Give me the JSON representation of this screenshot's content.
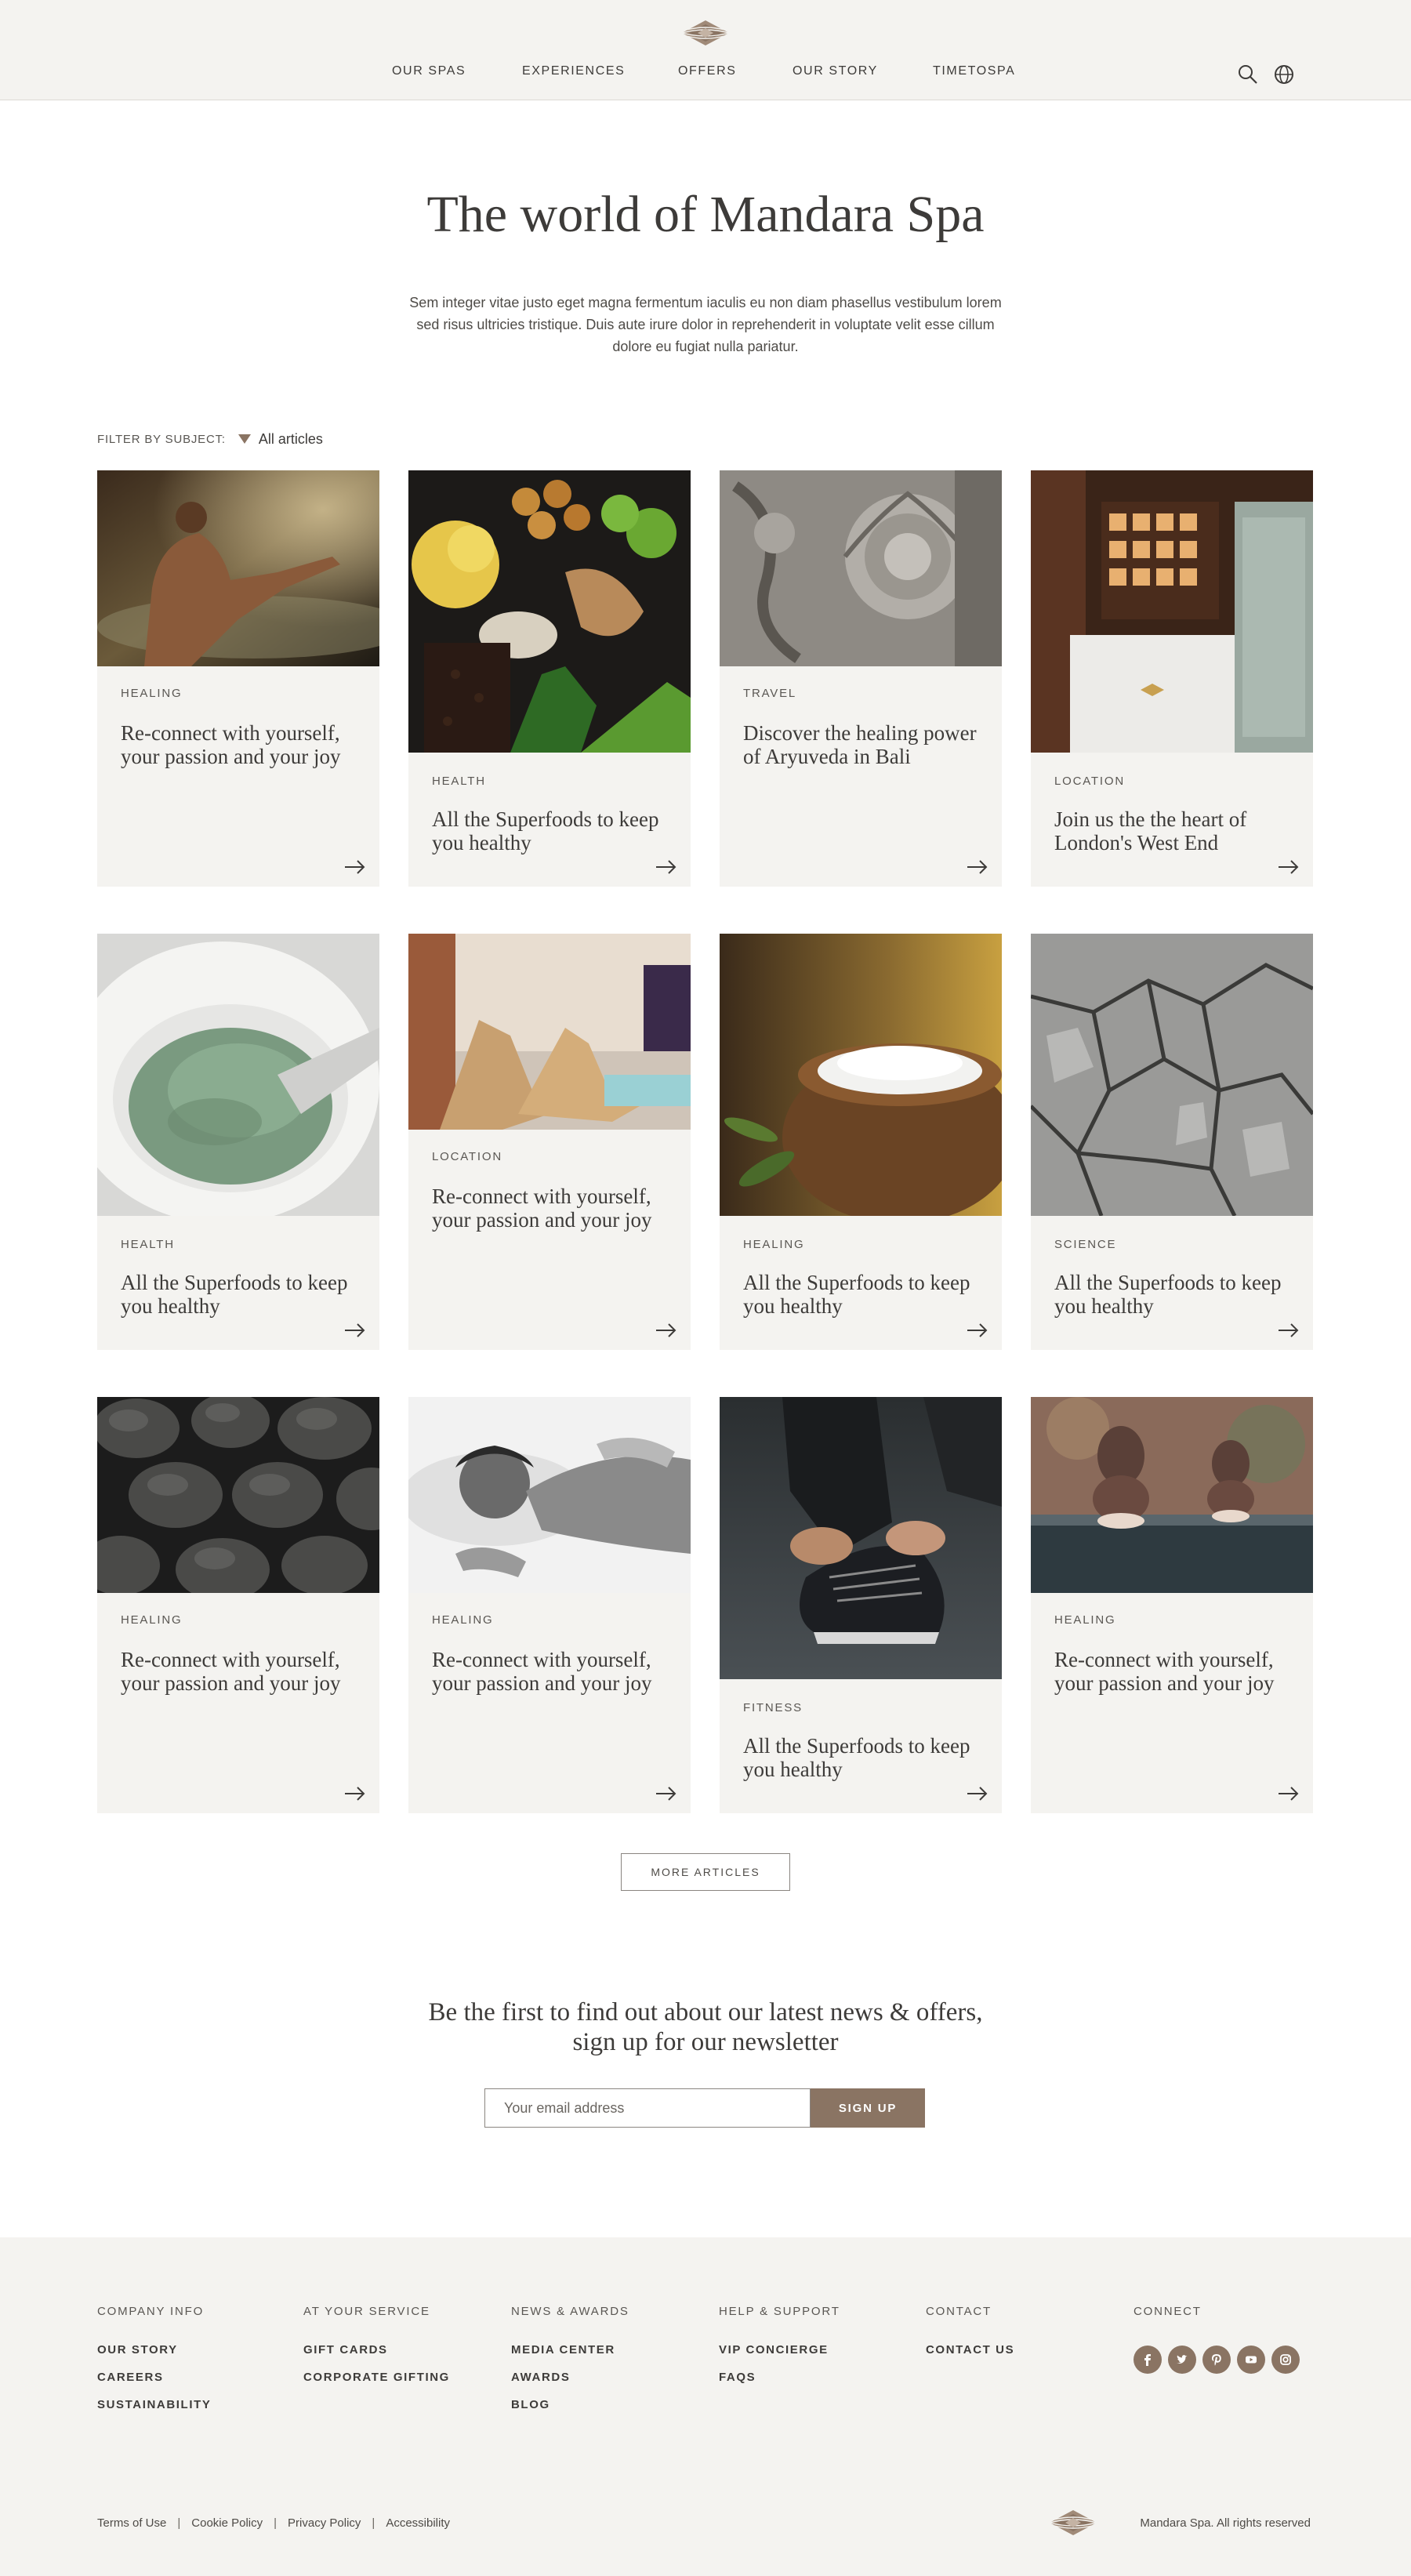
{
  "nav": {
    "items": [
      "OUR SPAS",
      "EXPERIENCES",
      "OFFERS",
      "OUR STORY",
      "TIMETOSPA"
    ]
  },
  "hero": {
    "title": "The world of Mandara Spa",
    "description": "Sem integer vitae justo eget magna fermentum iaculis eu non diam phasellus vestibulum lorem sed risus ultricies tristique. Duis aute irure dolor in reprehenderit in voluptate velit esse cillum dolore eu fugiat nulla pariatur."
  },
  "filter": {
    "label": "FILTER BY SUBJECT:",
    "value": "All articles"
  },
  "articles": [
    {
      "category": "HEALING",
      "title": "Re-connect with yourself, your passion and your joy",
      "image": "meditation-by-water"
    },
    {
      "category": "HEALTH",
      "title": "All the Superfoods to keep you healthy",
      "image": "superfoods-spices"
    },
    {
      "category": "TRAVEL",
      "title": "Discover the healing power of Aryuveda in Bali",
      "image": "stone-carving"
    },
    {
      "category": "LOCATION",
      "title": "Join us the the heart of London's West End",
      "image": "spa-reception"
    },
    {
      "category": "HEALTH",
      "title": "All the Superfoods to keep you healthy",
      "image": "green-powder-bowl"
    },
    {
      "category": "LOCATION",
      "title": "Re-connect with yourself, your passion and your joy",
      "image": "spa-loungers"
    },
    {
      "category": "HEALING",
      "title": "All the Superfoods to keep you healthy",
      "image": "salt-bowl"
    },
    {
      "category": "SCIENCE",
      "title": "All the Superfoods to keep you healthy",
      "image": "cracked-earth"
    },
    {
      "category": "HEALING",
      "title": "Re-connect with yourself, your passion and your joy",
      "image": "hot-stones"
    },
    {
      "category": "HEALING",
      "title": "Re-connect with yourself, your passion and your joy",
      "image": "massage"
    },
    {
      "category": "FITNESS",
      "title": "All the Superfoods to keep you healthy",
      "image": "running-shoe"
    },
    {
      "category": "HEALING",
      "title": "Re-connect with yourself, your passion and your joy",
      "image": "buddha-figurines"
    }
  ],
  "more_button": "MORE ARTICLES",
  "newsletter": {
    "title_line1": "Be the first to find out about our latest news & offers,",
    "title_line2": "sign up for our newsletter",
    "placeholder": "Your email address",
    "button": "SIGN UP"
  },
  "footer": {
    "columns": [
      {
        "heading": "COMPANY INFO",
        "links": [
          "OUR STORY",
          "CAREERS",
          "SUSTAINABILITY"
        ]
      },
      {
        "heading": "AT YOUR SERVICE",
        "links": [
          "GIFT CARDS",
          "CORPORATE GIFTING"
        ]
      },
      {
        "heading": "NEWS & AWARDS",
        "links": [
          "MEDIA CENTER",
          "AWARDS",
          "BLOG"
        ]
      },
      {
        "heading": "HELP & SUPPORT",
        "links": [
          "VIP CONCIERGE",
          "FAQS"
        ]
      },
      {
        "heading": "CONTACT",
        "links": [
          "CONTACT US"
        ]
      },
      {
        "heading": "CONNECT",
        "links": []
      }
    ],
    "social": [
      "facebook-icon",
      "twitter-icon",
      "pinterest-icon",
      "youtube-icon",
      "instagram-icon"
    ],
    "legal": [
      "Terms of Use",
      "Cookie Policy",
      "Privacy Policy",
      "Accessibility"
    ],
    "copyright": "Mandara Spa.  All rights reserved"
  },
  "colors": {
    "accent": "#8a7463",
    "text": "#3d3b39",
    "panel": "#f4f3f0"
  }
}
